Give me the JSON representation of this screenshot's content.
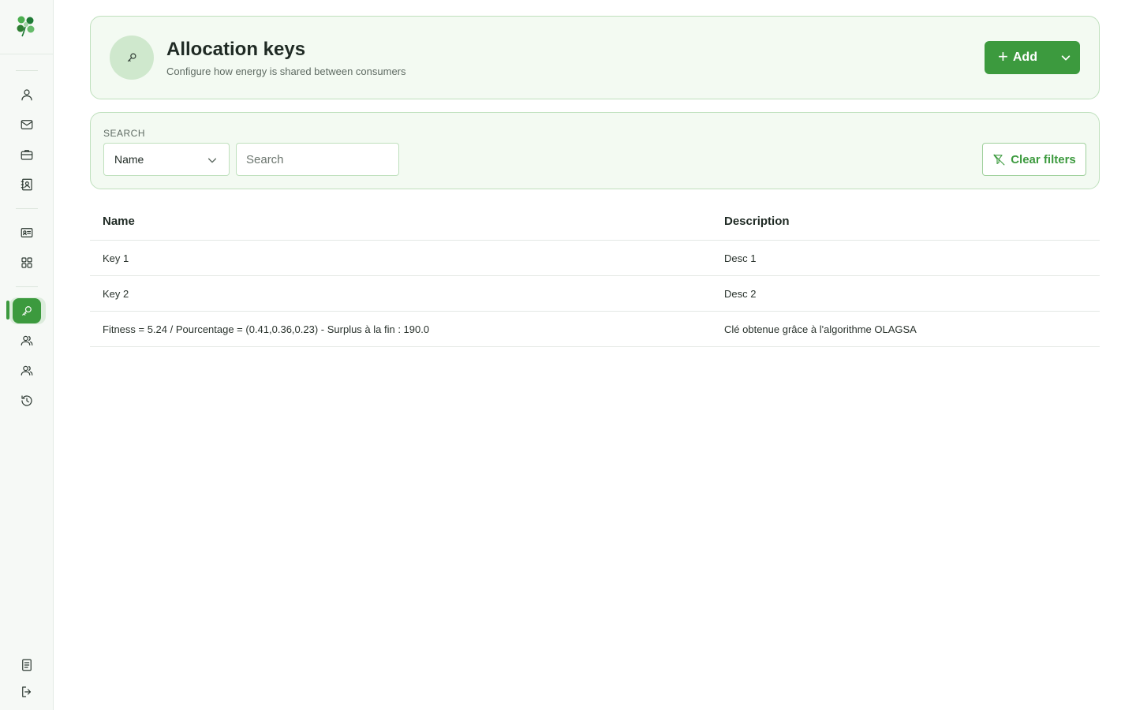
{
  "sidebar": {
    "logo_icon": "clover-logo-icon",
    "groups": [
      [
        {
          "name": "users",
          "icon": "user-icon"
        },
        {
          "name": "messages",
          "icon": "mail-icon"
        },
        {
          "name": "portfolio",
          "icon": "briefcase-icon"
        },
        {
          "name": "contacts",
          "icon": "contact-book-icon"
        }
      ],
      [
        {
          "name": "id-cards",
          "icon": "id-card-icon"
        },
        {
          "name": "dashboard",
          "icon": "grid-icon"
        }
      ],
      [
        {
          "name": "allocation-keys",
          "icon": "key-icon",
          "active": true
        },
        {
          "name": "consumers",
          "icon": "group-icon"
        },
        {
          "name": "producers",
          "icon": "group-icon"
        },
        {
          "name": "history",
          "icon": "history-icon"
        }
      ]
    ],
    "bottom": [
      {
        "name": "documentation",
        "icon": "document-icon"
      },
      {
        "name": "logout",
        "icon": "logout-icon"
      }
    ]
  },
  "header": {
    "icon": "key-icon",
    "title": "Allocation keys",
    "subtitle": "Configure how energy is shared between consumers",
    "add_label": "Add",
    "add_icon": "plus-icon",
    "dropdown_icon": "chevron-down-icon"
  },
  "search": {
    "label": "SEARCH",
    "field_selected": "Name",
    "placeholder": "Search",
    "value": "",
    "clear_label": "Clear filters",
    "clear_icon": "filter-clear-icon"
  },
  "table": {
    "columns": [
      "Name",
      "Description"
    ],
    "rows": [
      {
        "name": "Key 1",
        "description": "Desc 1"
      },
      {
        "name": "Key 2",
        "description": "Desc 2"
      },
      {
        "name": "Fitness = 5.24 / Pourcentage = (0.41,0.36,0.23) - Surplus à la fin : 190.0",
        "description": "Clé obtenue grâce à l'algorithme OLAGSA"
      }
    ]
  },
  "colors": {
    "accent": "#3c9a3e",
    "card_bg": "#f3faf2",
    "card_border": "#bfe0bd"
  }
}
